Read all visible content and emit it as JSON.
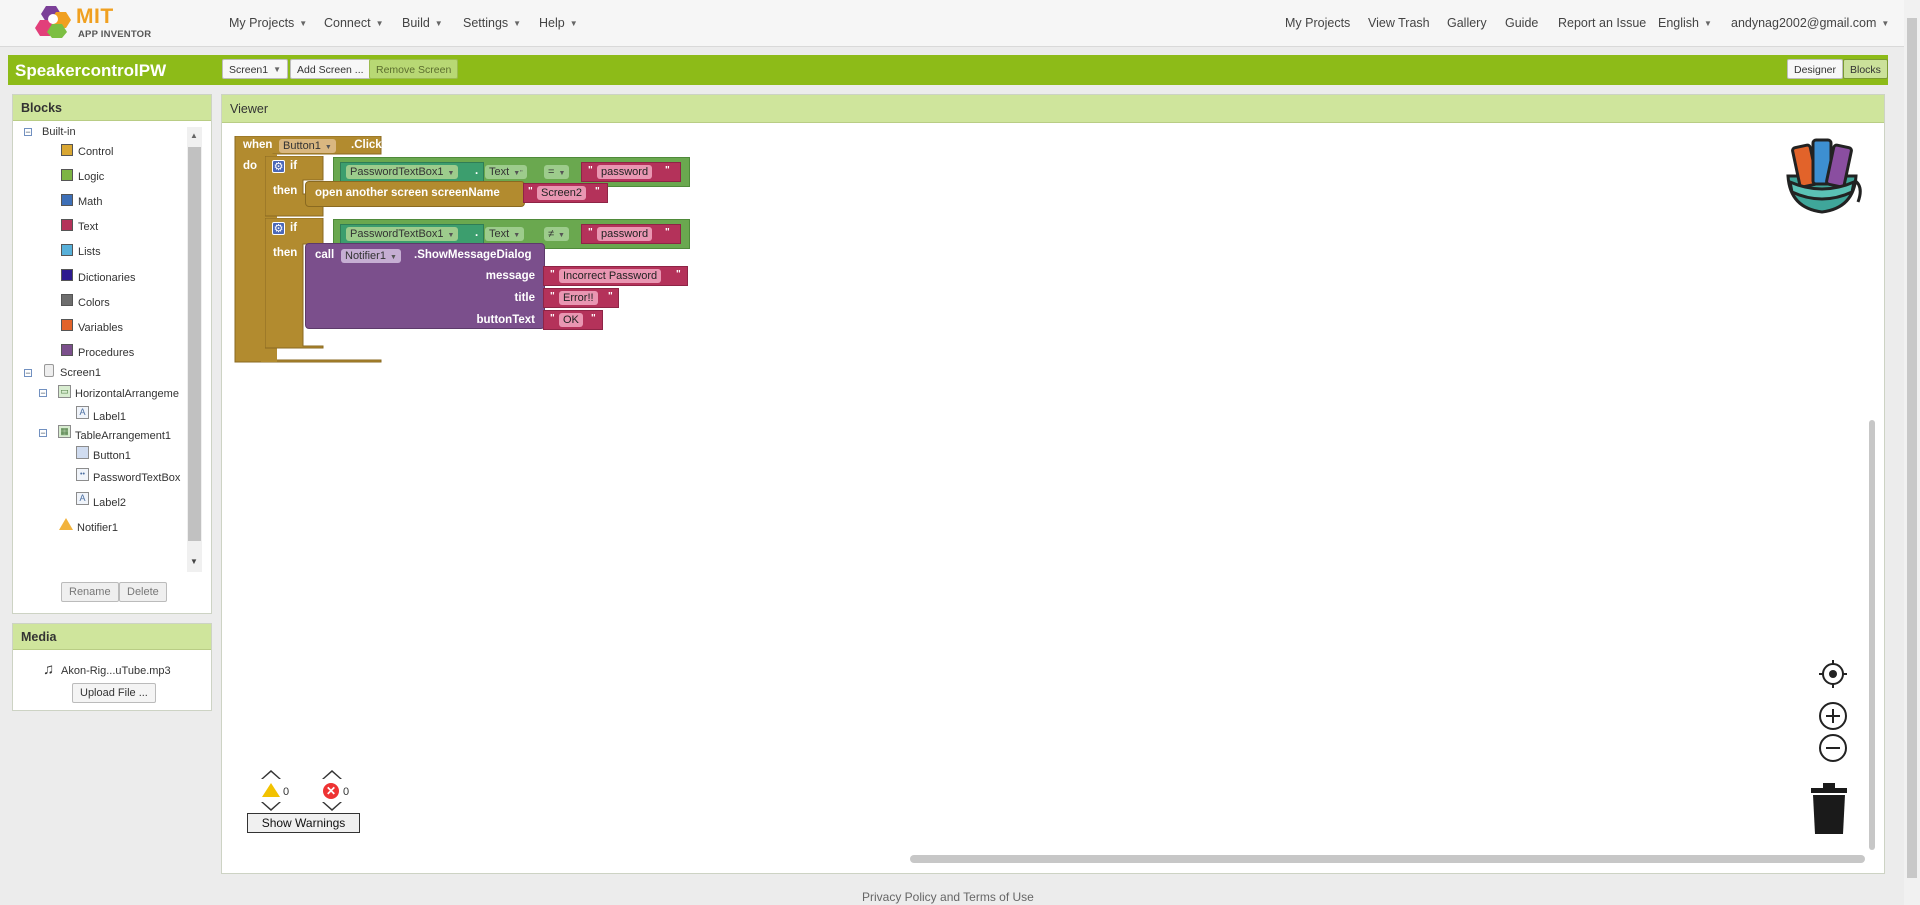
{
  "nav": {
    "logo_main": "MIT",
    "logo_sub": "APP INVENTOR",
    "left": [
      {
        "label": "My Projects"
      },
      {
        "label": "Connect"
      },
      {
        "label": "Build"
      },
      {
        "label": "Settings"
      },
      {
        "label": "Help"
      }
    ],
    "right": {
      "my_projects": "My Projects",
      "view_trash": "View Trash",
      "gallery": "Gallery",
      "guide": "Guide",
      "report": "Report an Issue",
      "language": "English",
      "account": "andynag2002@gmail.com"
    }
  },
  "projectbar": {
    "title": "SpeakercontrolPW",
    "screen_select": "Screen1",
    "add_screen": "Add Screen ...",
    "remove_screen": "Remove Screen",
    "designer": "Designer",
    "blocks": "Blocks"
  },
  "blocks_panel": {
    "title": "Blocks",
    "builtin_label": "Built-in",
    "builtin": [
      {
        "label": "Control",
        "color": "#d9a733"
      },
      {
        "label": "Logic",
        "color": "#7db444"
      },
      {
        "label": "Math",
        "color": "#3d6fb7"
      },
      {
        "label": "Text",
        "color": "#b4325a"
      },
      {
        "label": "Lists",
        "color": "#57b0d9"
      },
      {
        "label": "Dictionaries",
        "color": "#2d1a8f"
      },
      {
        "label": "Colors",
        "color": "#6d6d6d"
      },
      {
        "label": "Variables",
        "color": "#e2632a"
      },
      {
        "label": "Procedures",
        "color": "#7b4f8c"
      }
    ],
    "components": {
      "screen": "Screen1",
      "horizontal": "HorizontalArrangeme",
      "label1": "Label1",
      "table": "TableArrangement1",
      "button1": "Button1",
      "password": "PasswordTextBox",
      "label2": "Label2",
      "notifier": "Notifier1"
    },
    "rename": "Rename",
    "delete": "Delete"
  },
  "media_panel": {
    "title": "Media",
    "file": "Akon-Rig...uTube.mp3",
    "upload": "Upload File ..."
  },
  "viewer": {
    "title": "Viewer",
    "warnings_count": "0",
    "errors_count": "0",
    "show_warnings": "Show Warnings"
  },
  "blocks": {
    "when": "when",
    "button": "Button1",
    "click": ".Click",
    "do": "do",
    "if1": "if",
    "pw1": "PasswordTextBox1",
    "text1": "Text",
    "dot": ".",
    "eq": "=",
    "password1": "password",
    "then1": "then",
    "open_screen": "open another screen  screenName",
    "screen2": "Screen2",
    "if2": "if",
    "pw2": "PasswordTextBox1",
    "text2": "Text",
    "neq": "≠",
    "password2": "password",
    "then2": "then",
    "call": "call",
    "notifier": "Notifier1",
    "show_dialog": ".ShowMessageDialog",
    "message": "message",
    "message_val": "Incorrect Password",
    "title": "title",
    "title_val": "Error!!",
    "button_text": "buttonText",
    "button_text_val": "OK",
    "quote": "\""
  },
  "footer": "Privacy Policy and Terms of Use"
}
